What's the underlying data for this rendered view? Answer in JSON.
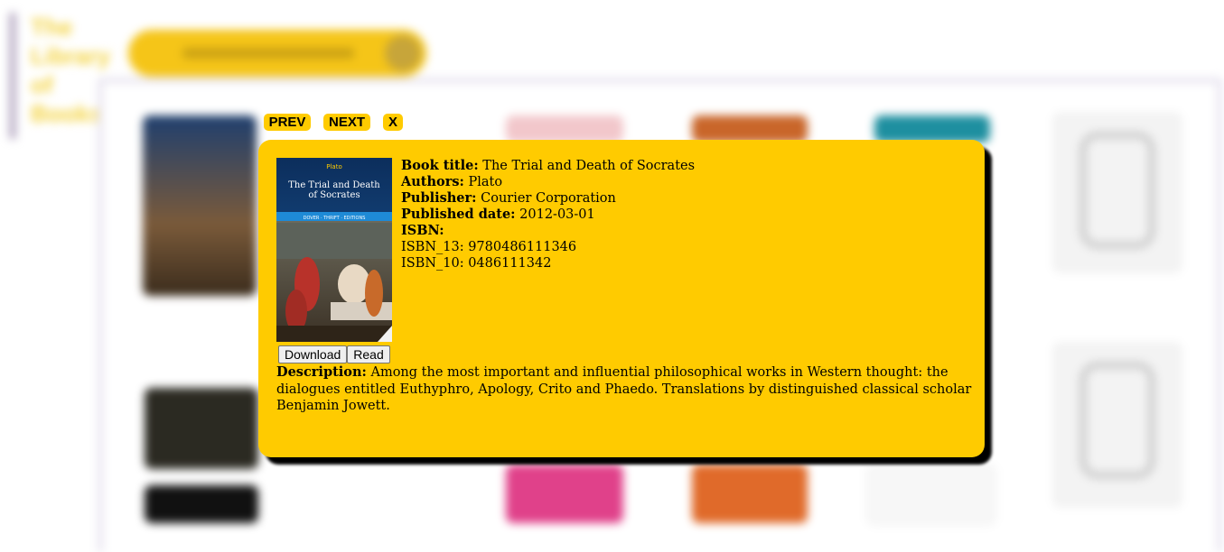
{
  "background": {
    "site_title": "The Library of Books",
    "site_title_lines": [
      "The",
      "Library",
      "of",
      "Books"
    ]
  },
  "modal": {
    "nav": {
      "prev": "PREV",
      "next": "NEXT",
      "close": "X"
    },
    "cover": {
      "author": "Plato",
      "title_line1": "The Trial and Death",
      "title_line2": "of Socrates",
      "series": "DOVER · THRIFT · EDITIONS"
    },
    "labels": {
      "title": "Book title:",
      "authors": "Authors:",
      "publisher": "Publisher:",
      "published_date": "Published date:",
      "isbn": "ISBN:",
      "description": "Description:"
    },
    "book": {
      "title": "The Trial and Death of Socrates",
      "authors": "Plato",
      "publisher": "Courier Corporation",
      "published_date": "2012-03-01",
      "isbn_13": "ISBN_13: 9780486111346",
      "isbn_10": "ISBN_10: 0486111342",
      "description": "Among the most important and influential philosophical works in Western thought: the dialogues entitled Euthyphro, Apology, Crito and Phaedo. Translations by distinguished classical scholar Benjamin Jowett."
    },
    "buttons": {
      "download": "Download",
      "read": "Read"
    }
  },
  "colors": {
    "accent": "#ffcb00",
    "shadow": "#000000"
  }
}
